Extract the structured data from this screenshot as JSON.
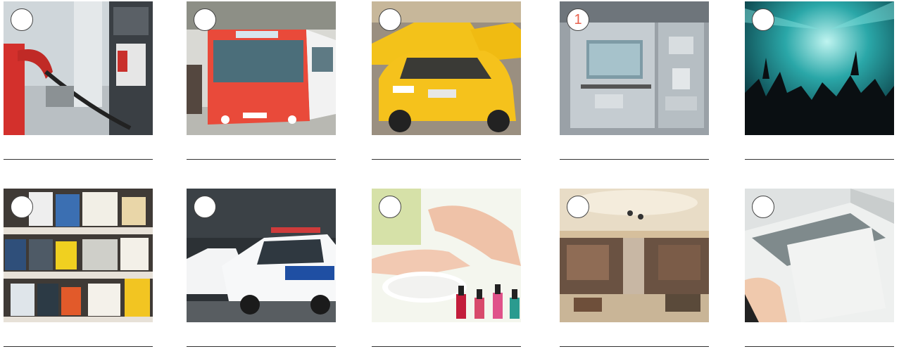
{
  "exercise": {
    "items": [
      {
        "label": "",
        "icon": "petrol-station-photo"
      },
      {
        "label": "",
        "icon": "airport-bus-photo"
      },
      {
        "label": "",
        "icon": "taxi-photo"
      },
      {
        "label": "1",
        "icon": "cash-machine-photo"
      },
      {
        "label": "",
        "icon": "concert-photo"
      },
      {
        "label": "",
        "icon": "bookshop-photo"
      },
      {
        "label": "",
        "icon": "police-car-photo"
      },
      {
        "label": "",
        "icon": "nail-salon-photo"
      },
      {
        "label": "",
        "icon": "department-store-photo"
      },
      {
        "label": "",
        "icon": "photocopier-photo"
      }
    ],
    "number_color": "#e8604c"
  }
}
